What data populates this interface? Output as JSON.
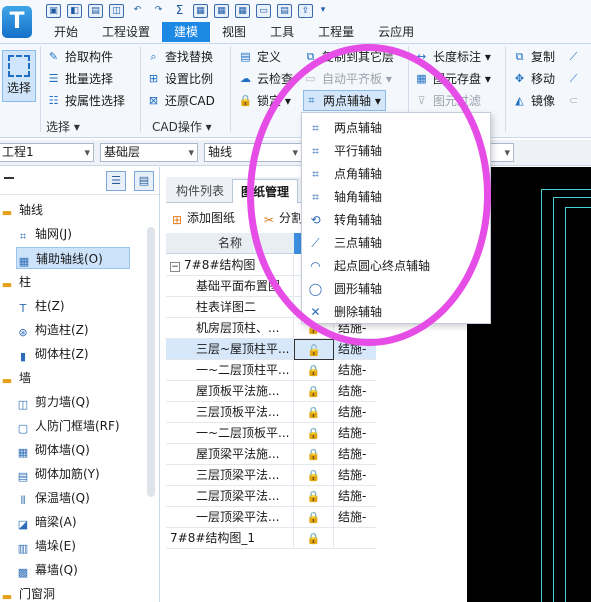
{
  "app": {
    "logo_letter": "T"
  },
  "quick_access": {
    "icons": [
      "save-icon",
      "undo-icon",
      "open-icon",
      "folder-icon",
      "undo-arrow-icon",
      "redo-arrow-icon",
      "sum-icon",
      "grid-icon",
      "grid2-icon",
      "grid3-icon",
      "doc-icon",
      "export-icon",
      "upload-icon",
      "more-icon"
    ]
  },
  "menu": {
    "items": [
      "开始",
      "工程设置",
      "建模",
      "视图",
      "工具",
      "工程量",
      "云应用"
    ],
    "active": "建模"
  },
  "ribbon": {
    "select": {
      "label": "选择",
      "group": "选择 ▾"
    },
    "select_group": [
      "拾取构件",
      "批量选择",
      "按属性选择"
    ],
    "cad_group": [
      "查找替换",
      "设置比例",
      "还原CAD"
    ],
    "cad_group_label": "CAD操作 ▾",
    "col3": [
      "定义",
      "云检查",
      "锁定 ▾"
    ],
    "col4": [
      "复制到其它层",
      "自动平齐板 ▾",
      "两点辅轴 ▾"
    ],
    "col5": [
      "长度标注 ▾",
      "图元存盘 ▾",
      "图元过滤"
    ],
    "col6": [
      "复制",
      "移动",
      "镜像"
    ]
  },
  "combos": {
    "project": "工程1",
    "layer": "基础层",
    "type": "轴线",
    "fourth": ""
  },
  "tree": {
    "items": [
      {
        "label": "轴线",
        "cat": true,
        "icon": "folder-icon"
      },
      {
        "label": "轴网(J)",
        "icon": "grid-icon"
      },
      {
        "label": "辅助轴线(O)",
        "icon": "aux-axis-icon",
        "selected": true
      },
      {
        "label": "柱",
        "cat": true,
        "icon": "folder-icon"
      },
      {
        "label": "柱(Z)",
        "icon": "column-icon"
      },
      {
        "label": "构造柱(Z)",
        "icon": "constructional-column-icon"
      },
      {
        "label": "砌体柱(Z)",
        "icon": "masonry-column-icon"
      },
      {
        "label": "墙",
        "cat": true,
        "icon": "folder-icon"
      },
      {
        "label": "剪力墙(Q)",
        "icon": "shear-wall-icon"
      },
      {
        "label": "人防门框墙(RF)",
        "icon": "door-frame-wall-icon"
      },
      {
        "label": "砌体墙(Q)",
        "icon": "masonry-wall-icon"
      },
      {
        "label": "砌体加筋(Y)",
        "icon": "reinforcement-icon"
      },
      {
        "label": "保温墙(Q)",
        "icon": "insulation-wall-icon"
      },
      {
        "label": "暗梁(A)",
        "icon": "hidden-beam-icon"
      },
      {
        "label": "墙垛(E)",
        "icon": "wall-pier-icon"
      },
      {
        "label": "幕墙(Q)",
        "icon": "curtain-wall-icon"
      },
      {
        "label": "门窗洞",
        "cat": true,
        "icon": "folder-icon"
      }
    ]
  },
  "panel": {
    "tabs": [
      "构件列表",
      "图纸管理"
    ],
    "active_tab": "图纸管理",
    "tools": [
      "添加图纸",
      "分割"
    ],
    "col_name": "名称",
    "rows": [
      {
        "name": "7#8#结构图",
        "group": true,
        "lock": "",
        "sheet": ""
      },
      {
        "name": "基础平面布置图",
        "lock": "",
        "sheet": ""
      },
      {
        "name": "柱表详图二",
        "lock": "",
        "sheet": ""
      },
      {
        "name": "机房层顶柱、...",
        "lock": "🔒",
        "sheet": "结施-"
      },
      {
        "name": "三层~屋顶柱平...",
        "lock": "🔓",
        "sheet": "结施-",
        "selected": true
      },
      {
        "name": "一~二层顶柱平...",
        "lock": "🔒",
        "sheet": "结施-"
      },
      {
        "name": "屋顶板平法施...",
        "lock": "🔒",
        "sheet": "结施-"
      },
      {
        "name": "三层顶板平法...",
        "lock": "🔒",
        "sheet": "结施-"
      },
      {
        "name": "一~二层顶板平...",
        "lock": "🔒",
        "sheet": "结施-"
      },
      {
        "name": "屋顶梁平法施...",
        "lock": "🔒",
        "sheet": "结施-"
      },
      {
        "name": "三层顶梁平法...",
        "lock": "🔒",
        "sheet": "结施-"
      },
      {
        "name": "二层顶梁平法...",
        "lock": "🔒",
        "sheet": "结施-"
      },
      {
        "name": "一层顶梁平法...",
        "lock": "🔒",
        "sheet": "结施-"
      },
      {
        "name": "7#8#结构图_1",
        "lock": "🔒",
        "sheet": ""
      }
    ]
  },
  "dropdown": {
    "items": [
      {
        "label": "两点辅轴",
        "icon": "two-point-axis-icon"
      },
      {
        "label": "平行辅轴",
        "icon": "parallel-axis-icon"
      },
      {
        "label": "点角辅轴",
        "icon": "point-angle-axis-icon"
      },
      {
        "label": "轴角辅轴",
        "icon": "axis-angle-axis-icon"
      },
      {
        "label": "转角辅轴",
        "icon": "rotation-axis-icon"
      },
      {
        "label": "三点辅轴",
        "icon": "three-point-axis-icon"
      },
      {
        "label": "起点圆心终点辅轴",
        "icon": "arc-center-axis-icon"
      },
      {
        "label": "圆形辅轴",
        "icon": "circle-axis-icon"
      },
      {
        "label": "删除辅轴",
        "icon": "delete-axis-icon"
      }
    ]
  },
  "colors": {
    "accent": "#1e88e5",
    "annotation": "#e64ce6",
    "canvas": "#000000",
    "canvas_line": "#3ed2d8"
  }
}
